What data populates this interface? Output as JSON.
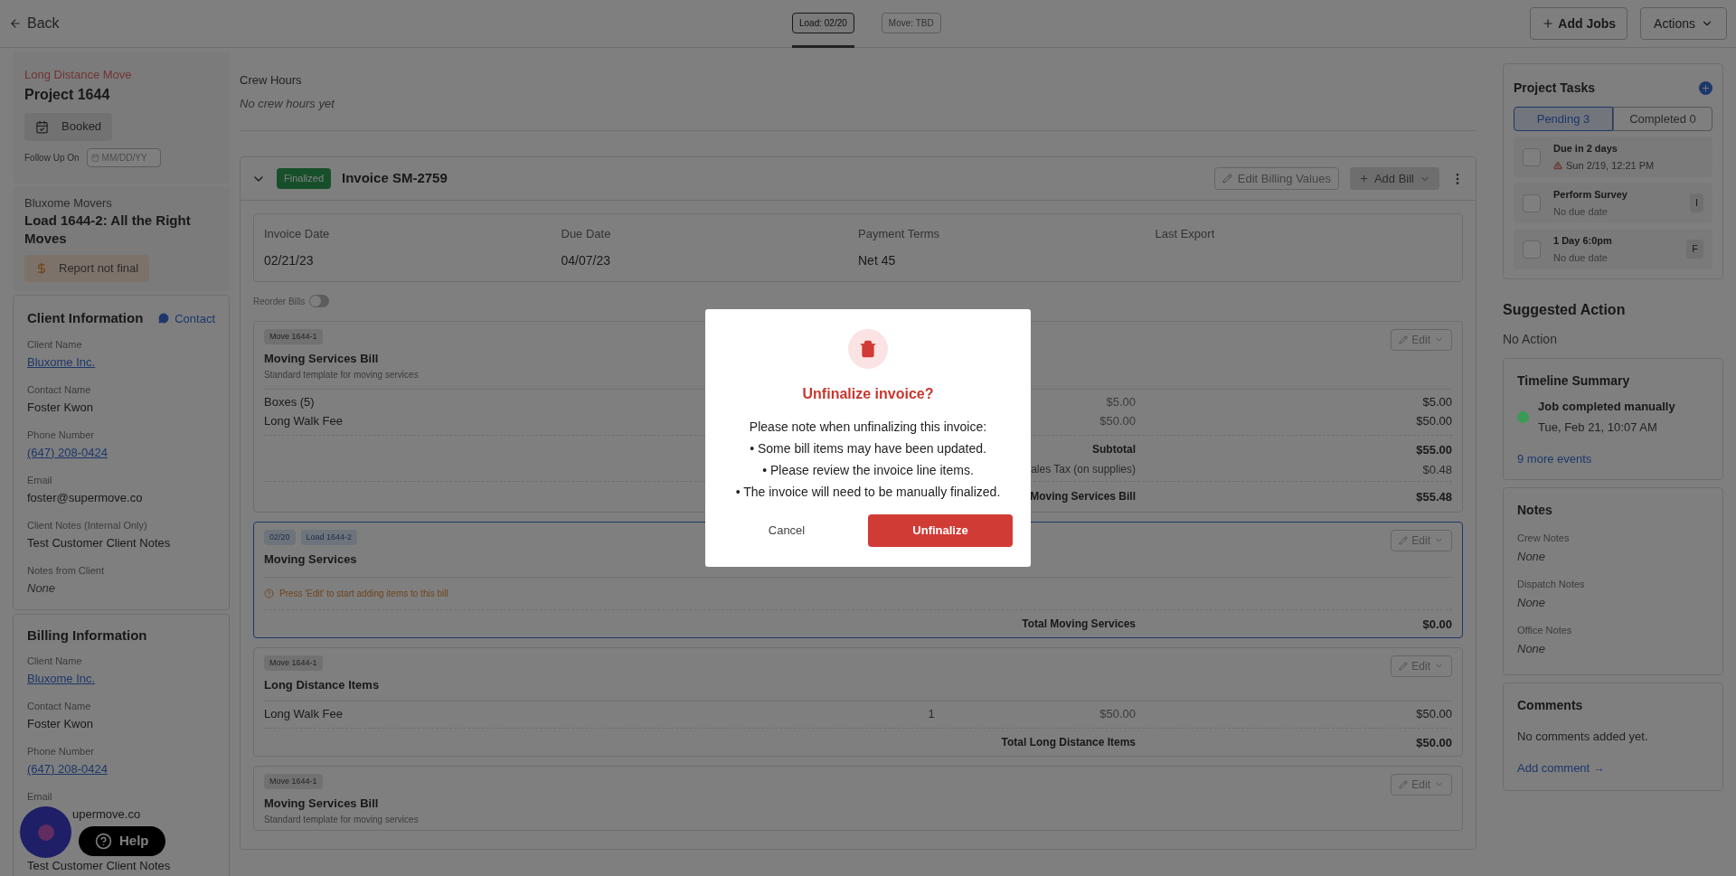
{
  "header": {
    "back": "Back",
    "tabs": [
      {
        "label": "Load: 02/20",
        "selected": true
      },
      {
        "label": "Move: TBD",
        "selected": false
      }
    ],
    "add_jobs": "Add Jobs",
    "actions": "Actions"
  },
  "project": {
    "type": "Long Distance Move",
    "title": "Project 1644",
    "status": "Booked",
    "follow_up_label": "Follow Up On",
    "follow_up_placeholder": "MM/DD/YY"
  },
  "load": {
    "company": "Bluxome Movers",
    "title": "Load 1644-2: All the Right Moves",
    "report_status": "Report not final"
  },
  "client_information": {
    "title": "Client Information",
    "contact": "Contact",
    "fields": [
      {
        "label": "Client Name",
        "value": "Bluxome Inc.",
        "kind": "link"
      },
      {
        "label": "Contact Name",
        "value": "Foster Kwon",
        "kind": "text"
      },
      {
        "label": "Phone Number",
        "value": "(647) 208-0424",
        "kind": "link"
      },
      {
        "label": "Email",
        "value": "foster@supermove.co",
        "kind": "text"
      },
      {
        "label": "Client Notes (Internal Only)",
        "value": "Test Customer Client Notes",
        "kind": "text"
      },
      {
        "label": "Notes from Client",
        "value": "None",
        "kind": "empty"
      }
    ]
  },
  "billing_information": {
    "title": "Billing Information",
    "fields": [
      {
        "label": "Client Name",
        "value": "Bluxome Inc.",
        "kind": "link"
      },
      {
        "label": "Contact Name",
        "value": "Foster Kwon",
        "kind": "text"
      },
      {
        "label": "Phone Number",
        "value": "(647) 208-0424",
        "kind": "link"
      },
      {
        "label": "Email",
        "value": "upermove.co",
        "kind": "clipped"
      },
      {
        "value": "Test Customer Client Notes",
        "kind": "text"
      }
    ]
  },
  "crew_hours": {
    "label": "Crew Hours",
    "value": "No crew hours yet"
  },
  "invoice": {
    "status": "Finalized",
    "title": "Invoice SM-2759",
    "edit_billing": "Edit Billing Values",
    "add_bill": "Add Bill",
    "info": [
      {
        "label": "Invoice Date",
        "value": "02/21/23"
      },
      {
        "label": "Due Date",
        "value": "04/07/23"
      },
      {
        "label": "Payment Terms",
        "value": "Net 45"
      },
      {
        "label": "Last Export"
      }
    ],
    "reorder": {
      "label": "Reorder Bills",
      "on": false
    },
    "bills": [
      {
        "tags": [
          {
            "label": "Move 1644-1",
            "kind": "move"
          }
        ],
        "title": "Moving Services Bill",
        "subtitle": "Standard template for moving services",
        "selected": false,
        "edit": "Edit",
        "items": [
          {
            "name": "Boxes (5)",
            "price": "$5.00",
            "total": "$5.00"
          },
          {
            "name": "Long Walk Fee",
            "price": "$50.00",
            "total": "$50.00"
          }
        ],
        "summary": [
          {
            "label": "Subtotal",
            "value": "$55.00",
            "kind": "total"
          },
          {
            "label": "ales Tax (on supplies)",
            "value": "$0.48",
            "kind": "line"
          },
          {
            "label": "Moving Services Bill",
            "value": "$55.48",
            "kind": "total"
          }
        ]
      },
      {
        "tags": [
          {
            "label": "02/20",
            "kind": "load"
          },
          {
            "label": "Load 1644-2",
            "kind": "load"
          }
        ],
        "title": "Moving Services",
        "selected": true,
        "edit": "Edit",
        "notice": "Press 'Edit' to start adding items to this bill",
        "summary": [
          {
            "label": "Total Moving Services",
            "value": "$0.00",
            "kind": "total"
          }
        ]
      },
      {
        "tags": [
          {
            "label": "Move 1644-1",
            "kind": "move"
          }
        ],
        "title": "Long Distance Items",
        "selected": false,
        "edit": "Edit",
        "items": [
          {
            "name": "Long Walk Fee",
            "quantity": "1",
            "price": "$50.00",
            "total": "$50.00"
          }
        ],
        "summary": [
          {
            "label": "Total Long Distance Items",
            "value": "$50.00",
            "kind": "total"
          }
        ]
      },
      {
        "tags": [
          {
            "label": "Move 1644-1",
            "kind": "move"
          }
        ],
        "title": "Moving Services Bill",
        "subtitle": "Standard template for moving services",
        "selected": false,
        "edit": "Edit"
      }
    ]
  },
  "project_tasks": {
    "title": "Project Tasks",
    "tabs": [
      {
        "label": "Pending 3",
        "selected": true
      },
      {
        "label": "Completed 0",
        "selected": false
      }
    ],
    "tasks": [
      {
        "title": "Due in 2 days",
        "due": "Sun 2/19, 12:21 PM",
        "overdue": true,
        "checked": false
      },
      {
        "title": "Perform Survey",
        "due": "No due date",
        "overdue": false,
        "checked": false,
        "badge": "I"
      },
      {
        "title": "1 Day 6:0pm",
        "due": "No due date",
        "overdue": false,
        "checked": false,
        "badge": "F"
      }
    ]
  },
  "suggested_action": {
    "title": "Suggested Action",
    "value": "No Action"
  },
  "timeline_summary": {
    "title": "Timeline Summary",
    "events": [
      {
        "title": "Job completed manually",
        "time": "Tue, Feb 21, 10:07 AM",
        "color": "#3a9a56"
      }
    ],
    "more": "9 more events"
  },
  "notes": {
    "title": "Notes",
    "fields": [
      {
        "label": "Crew Notes",
        "value": "None"
      },
      {
        "label": "Dispatch Notes",
        "value": "None"
      },
      {
        "label": "Office Notes",
        "value": "None"
      }
    ]
  },
  "comments": {
    "title": "Comments",
    "empty": "No comments added yet.",
    "add": "Add comment →"
  },
  "help": {
    "label": "Help"
  },
  "modal": {
    "title": "Unfinalize invoice?",
    "lines": [
      "Please note when unfinalizing this invoice:",
      "• Some bill items may have been updated.",
      "• Please review the invoice line items.",
      "• The invoice will need to be manually finalized."
    ],
    "cancel": "Cancel",
    "confirm": "Unfinalize"
  }
}
